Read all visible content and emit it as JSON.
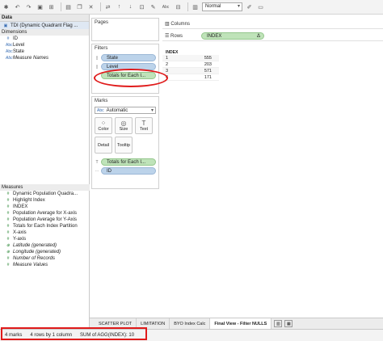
{
  "toolbar": {
    "zoom_mode": "Normal",
    "abc_label": "Abc"
  },
  "data_pane": {
    "header": "Data",
    "datasource": "TDI (Dynamic Quadrant Flag ...",
    "dimensions_header": "Dimensions",
    "dimensions": [
      {
        "label": "ID",
        "icon": "#",
        "italic": false
      },
      {
        "label": "Level",
        "icon": "Abc",
        "italic": false
      },
      {
        "label": "State",
        "icon": "Abc",
        "italic": false
      },
      {
        "label": "Measure Names",
        "icon": "Abc",
        "italic": true
      }
    ],
    "measures_header": "Measures",
    "measures": [
      {
        "label": "Dynamic Population Quadra...",
        "icon": "#",
        "italic": false
      },
      {
        "label": "Highlight Index",
        "icon": "#",
        "italic": false
      },
      {
        "label": "INDEX",
        "icon": "#",
        "italic": false
      },
      {
        "label": "Population Average for X-axis",
        "icon": "#",
        "italic": false
      },
      {
        "label": "Population Average for Y-Axis",
        "icon": "#",
        "italic": false
      },
      {
        "label": "Totals for Each Index Partition",
        "icon": "#",
        "italic": false
      },
      {
        "label": "X-axis",
        "icon": "#",
        "italic": false
      },
      {
        "label": "Y-axis",
        "icon": "#",
        "italic": false
      },
      {
        "label": "Latitude (generated)",
        "icon": "⊕",
        "italic": true
      },
      {
        "label": "Longitude (generated)",
        "icon": "⊕",
        "italic": true
      },
      {
        "label": "Number of Records",
        "icon": "#",
        "italic": true
      },
      {
        "label": "Measure Values",
        "icon": "#",
        "italic": true
      }
    ]
  },
  "pages": {
    "title": "Pages"
  },
  "filters": {
    "title": "Filters",
    "items": [
      "State",
      "Level",
      "Totals for Each I..."
    ]
  },
  "marks": {
    "title": "Marks",
    "type": "Automatic",
    "type_icon": "Abc",
    "buttons": [
      "Color",
      "Size",
      "Text",
      "Detail",
      "Tooltip"
    ],
    "pills": [
      "Totals for Each I...",
      "ID"
    ]
  },
  "shelves": {
    "columns_label": "Columns",
    "rows_label": "Rows",
    "rows_pill": "INDEX",
    "delta": "Δ"
  },
  "view": {
    "header": "INDEX",
    "rows": [
      {
        "k": "1",
        "v": "555"
      },
      {
        "k": "2",
        "v": "203"
      },
      {
        "k": "3",
        "v": "571"
      },
      {
        "k": "4",
        "v": "171"
      }
    ]
  },
  "tabs": [
    {
      "label": "SCATTER PLOT",
      "active": false
    },
    {
      "label": "LIMITATION",
      "active": false
    },
    {
      "label": "BYO Index Calc",
      "active": false
    },
    {
      "label": "Final View - Filter NULLS",
      "active": true
    }
  ],
  "status": {
    "marks": "4 marks",
    "rows": "4 rows by 1 column",
    "sum": "SUM of AGG(INDEX): 10"
  },
  "colors": {
    "accent_red": "#e01b1b",
    "pill_blue": "#bcd3ea",
    "pill_green": "#bfe3b9"
  }
}
